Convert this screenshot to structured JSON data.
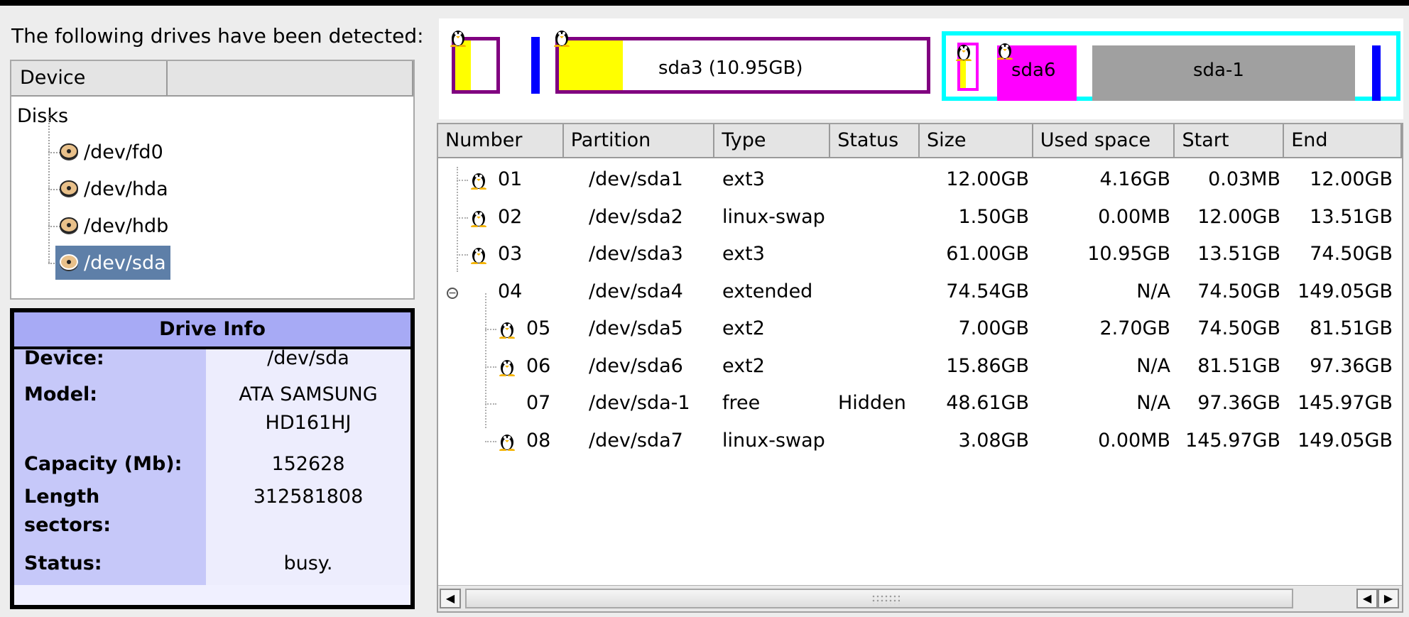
{
  "drives_panel": {
    "label": "The following drives have been detected:",
    "column_header": "Device",
    "root_label": "Disks",
    "devices": [
      "/dev/fd0",
      "/dev/hda",
      "/dev/hdb",
      "/dev/sda"
    ],
    "selected_device": "/dev/sda"
  },
  "drive_info": {
    "title": "Drive Info",
    "rows": [
      {
        "key": "Device:",
        "value": "/dev/sda"
      },
      {
        "key": "Model:",
        "value": "ATA SAMSUNG HD161HJ"
      },
      {
        "key": "Capacity (Mb):",
        "value": "152628"
      },
      {
        "key": "Length sectors:",
        "value": "312581808"
      },
      {
        "key": "Status:",
        "value": "busy."
      }
    ]
  },
  "partition_map": {
    "labels": {
      "sda3": "sda3 (10.95GB)",
      "sda6": "sda6",
      "free": "sda-1"
    },
    "colors": {
      "primary_border": "#800080",
      "extended_border": "#00ffff",
      "swap": "#0000ff",
      "used": "#ffff00",
      "sda6": "#ff00ff",
      "free": "#a0a0a0"
    }
  },
  "partition_table": {
    "columns": [
      "Number",
      "Partition",
      "Type",
      "Status",
      "Size",
      "Used space",
      "Start",
      "End"
    ],
    "rows": [
      {
        "number": "01",
        "partition": "/dev/sda1",
        "type": "ext3",
        "status": "",
        "size": "12.00GB",
        "used": "4.16GB",
        "start": "0.03MB",
        "end": "12.00GB",
        "icon": "tux"
      },
      {
        "number": "02",
        "partition": "/dev/sda2",
        "type": "linux-swap",
        "status": "",
        "size": "1.50GB",
        "used": "0.00MB",
        "start": "12.00GB",
        "end": "13.51GB",
        "icon": "tux"
      },
      {
        "number": "03",
        "partition": "/dev/sda3",
        "type": "ext3",
        "status": "",
        "size": "61.00GB",
        "used": "10.95GB",
        "start": "13.51GB",
        "end": "74.50GB",
        "icon": "tux"
      },
      {
        "number": "04",
        "partition": "/dev/sda4",
        "type": "extended",
        "status": "",
        "size": "74.54GB",
        "used": "N/A",
        "start": "74.50GB",
        "end": "149.05GB",
        "icon": "expander"
      },
      {
        "number": "05",
        "partition": "/dev/sda5",
        "type": "ext2",
        "status": "",
        "size": "7.00GB",
        "used": "2.70GB",
        "start": "74.50GB",
        "end": "81.51GB",
        "icon": "tux"
      },
      {
        "number": "06",
        "partition": "/dev/sda6",
        "type": "ext2",
        "status": "",
        "size": "15.86GB",
        "used": "N/A",
        "start": "81.51GB",
        "end": "97.36GB",
        "icon": "tux"
      },
      {
        "number": "07",
        "partition": "/dev/sda-1",
        "type": "free",
        "status": "Hidden",
        "size": "48.61GB",
        "used": "N/A",
        "start": "97.36GB",
        "end": "145.97GB",
        "icon": "none"
      },
      {
        "number": "08",
        "partition": "/dev/sda7",
        "type": "linux-swap",
        "status": "",
        "size": "3.08GB",
        "used": "0.00MB",
        "start": "145.97GB",
        "end": "149.05GB",
        "icon": "tux"
      }
    ]
  }
}
